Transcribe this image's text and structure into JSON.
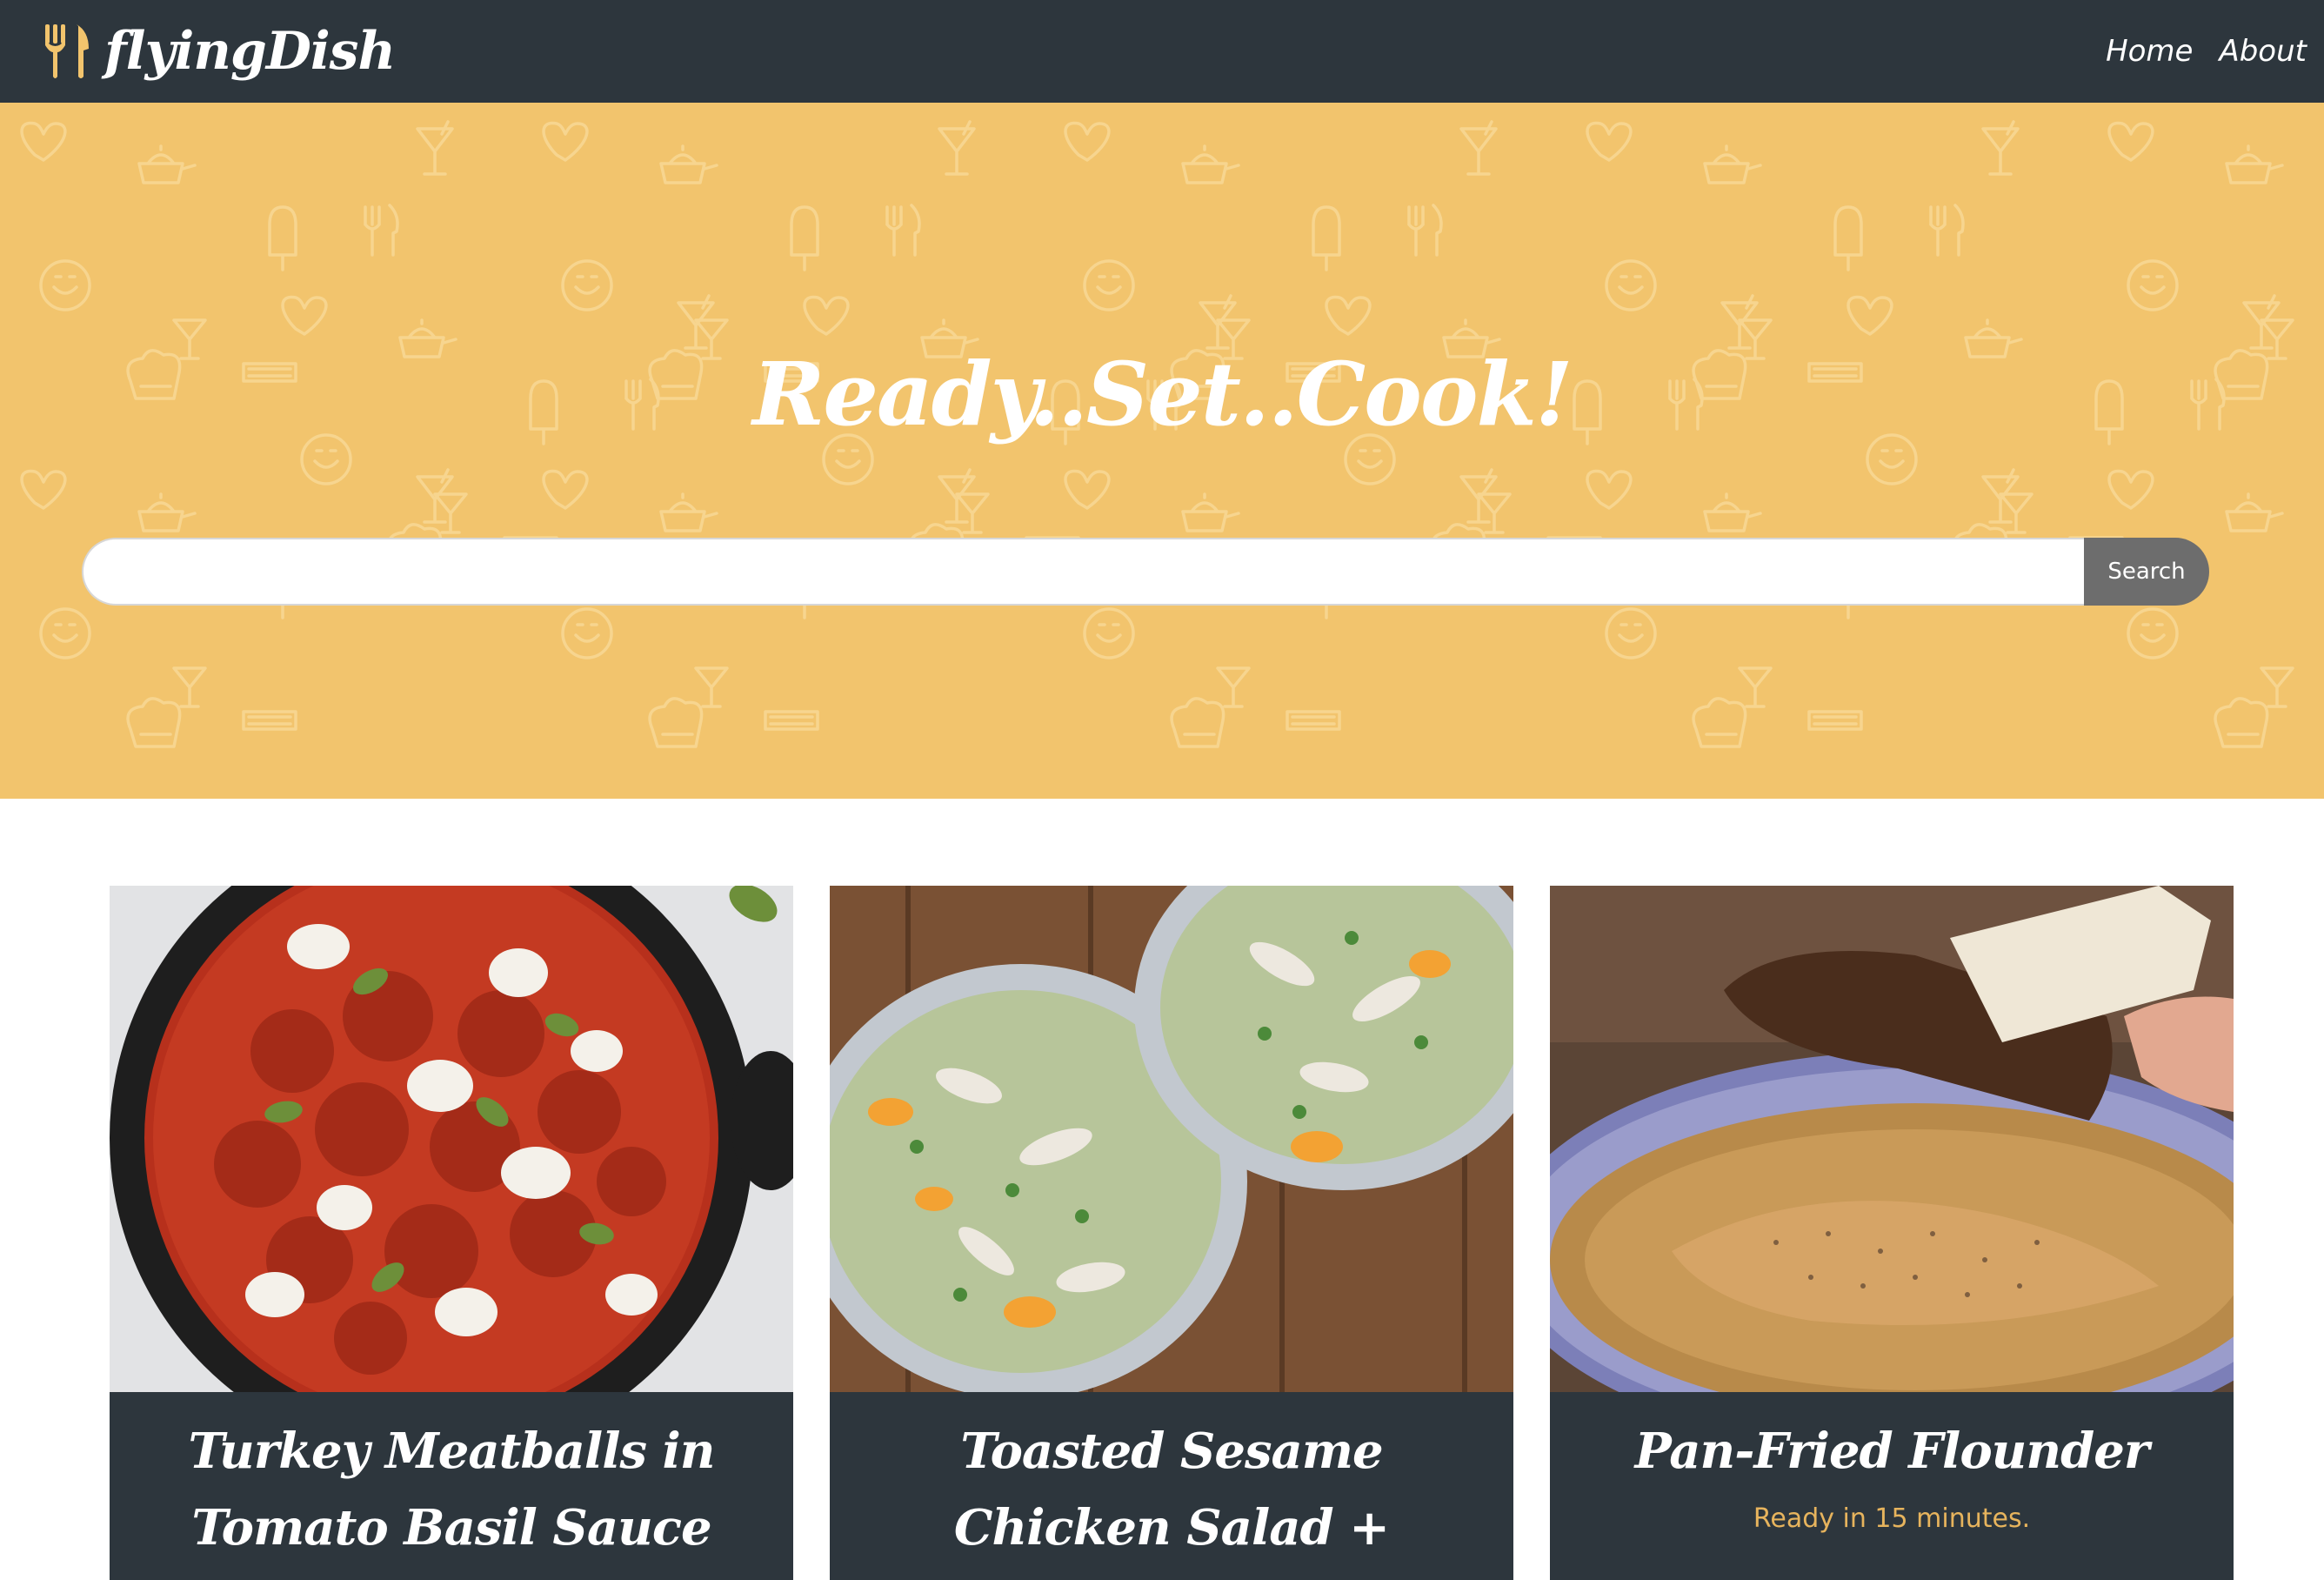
{
  "navbar": {
    "brand_name": "flyingDish",
    "brand_icon": "fork-knife-icon",
    "links": [
      "Home",
      "About"
    ]
  },
  "hero": {
    "title": "Ready..Set..Cook!",
    "search_placeholder": "",
    "search_value": "",
    "search_button": "Search",
    "background_color": "#f2c46d"
  },
  "recipes": [
    {
      "title": "Turkey Meatballs in Tomato Basil Sauce with Burrata",
      "subtitle": "",
      "image": "meatballs-skillet-photo"
    },
    {
      "title": "Toasted Sesame Chicken Salad + Weekly Menu",
      "subtitle": "",
      "image": "chicken-salad-photo"
    },
    {
      "title": "Pan-Fried Flounder",
      "subtitle": "Ready in 15 minutes.",
      "image": "flounder-pan-photo"
    }
  ],
  "colors": {
    "navbar": "#2d363d",
    "accent": "#f2c46d",
    "subtitle": "#e7b45d",
    "search_button": "#6d6d6d"
  }
}
